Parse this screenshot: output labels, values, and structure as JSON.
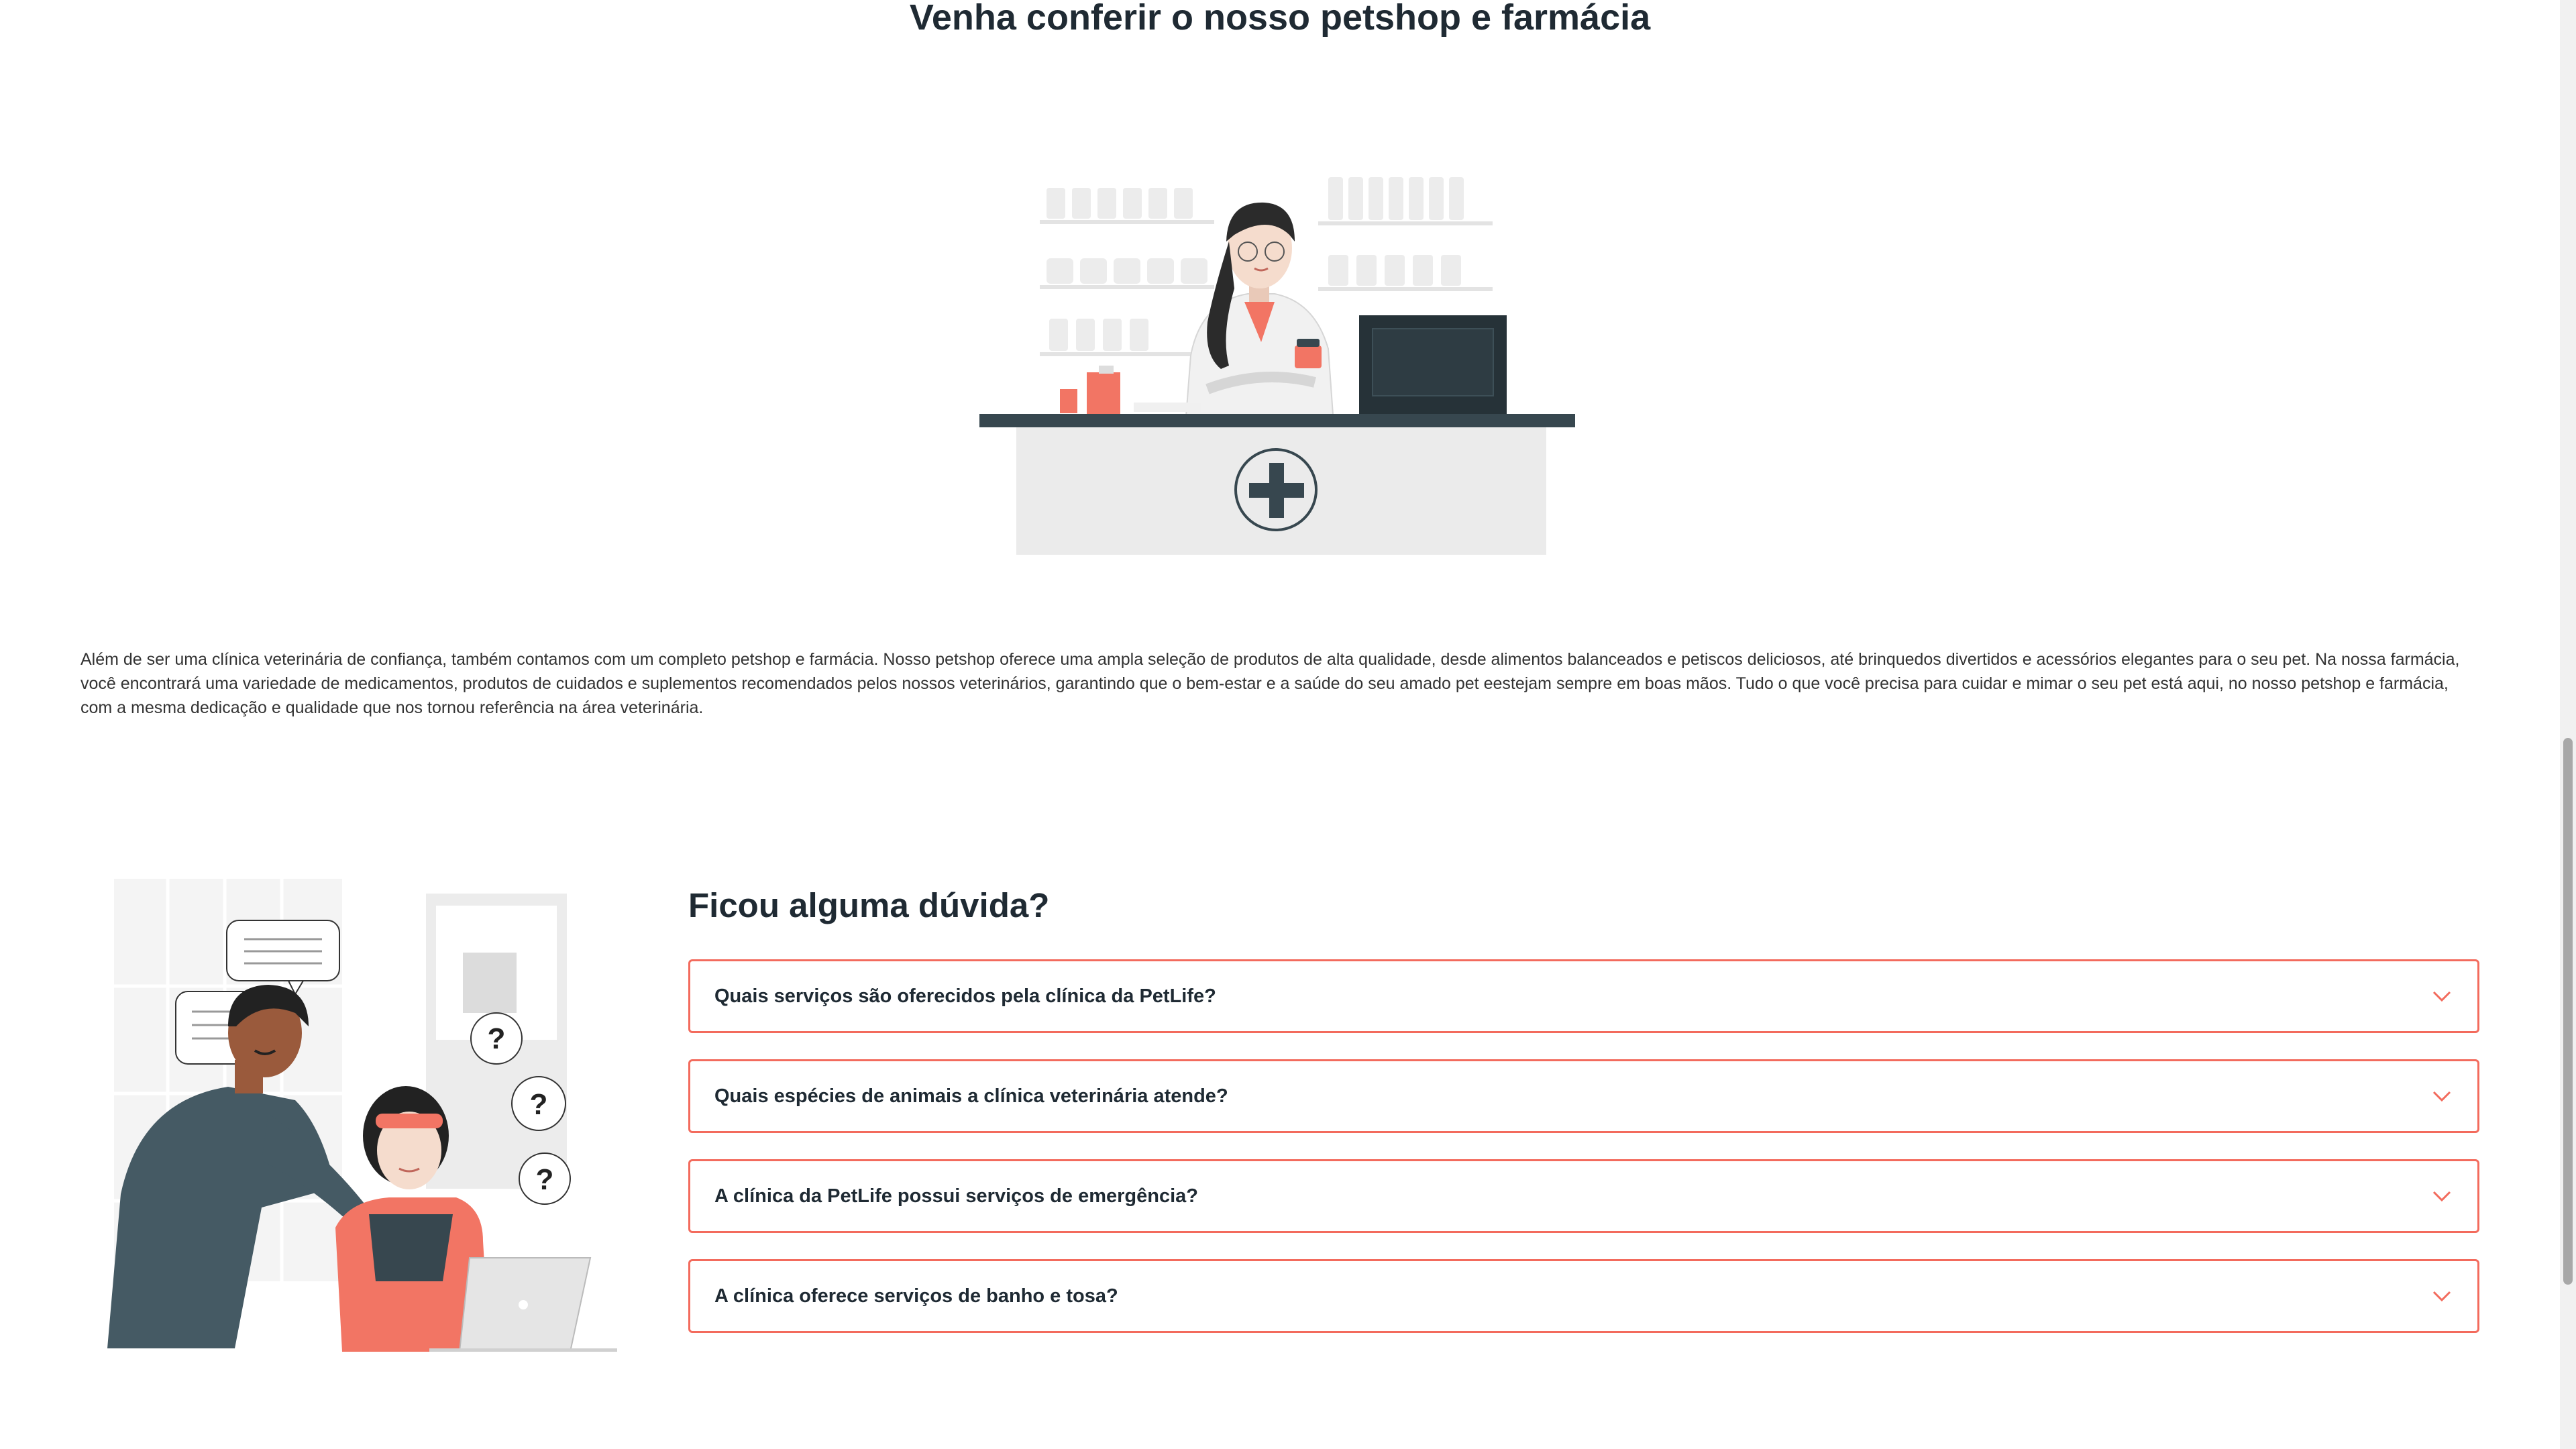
{
  "petshop_section": {
    "title": "Venha conferir o nosso petshop e farmácia",
    "description": "Além de ser uma clínica veterinária de confiança, também contamos com um completo petshop e farmácia. Nosso petshop oferece uma ampla seleção de produtos de alta qualidade, desde alimentos balanceados e petiscos deliciosos, até brinquedos divertidos e acessórios elegantes para o seu pet. Na nossa farmácia, você encontrará uma variedade de medicamentos, produtos de cuidados e suplementos recomendados pelos nossos veterinários, garantindo que o bem-estar e a saúde do seu amado pet eestejam sempre em boas mãos. Tudo o que você precisa para cuidar e mimar o seu pet está aqui, no nosso petshop e farmácia, com a mesma dedicação e qualidade que nos tornou referência na área veterinária.",
    "illustration": "pharmacist-at-counter-illustration"
  },
  "faq_section": {
    "title": "Ficou alguma dúvida?",
    "illustration": "people-with-questions-illustration",
    "items": [
      {
        "question": "Quais serviços são oferecidos pela clínica da PetLife?",
        "icon": "chevron-down-icon"
      },
      {
        "question": "Quais espécies de animais a clínica veterinária atende?",
        "icon": "chevron-down-icon"
      },
      {
        "question": "A clínica da PetLife possui serviços de emergência?",
        "icon": "chevron-down-icon"
      },
      {
        "question": "A clínica oferece serviços de banho e tosa?",
        "icon": "chevron-down-icon"
      }
    ]
  },
  "colors": {
    "accent": "#f36b5d",
    "heading": "#1f2a33",
    "text": "#333333",
    "illustration_dark": "#37474f",
    "illustration_coral": "#f27564"
  }
}
